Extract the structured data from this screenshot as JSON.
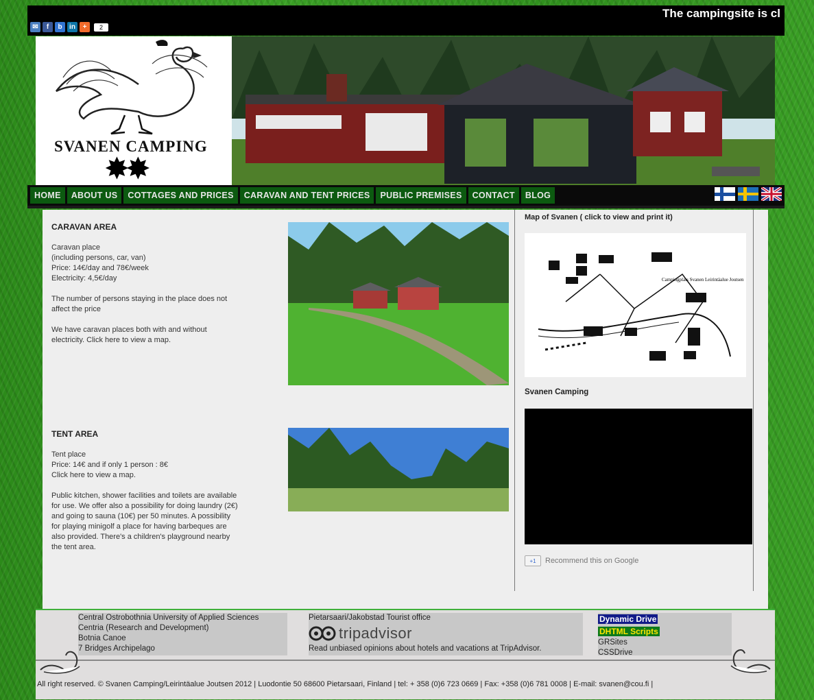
{
  "ticker": "The campingsite is cl",
  "share": {
    "icons": [
      "email-icon",
      "facebook-icon",
      "delicious-icon",
      "linkedin-icon",
      "google-plus-icon"
    ],
    "count": "2"
  },
  "logo": {
    "title": "SVANEN CAMPING"
  },
  "nav": {
    "items": [
      "HOME",
      "ABOUT US",
      "COTTAGES AND PRICES",
      "CARAVAN AND TENT PRICES",
      "PUBLIC PREMISES",
      "CONTACT",
      "BLOG"
    ]
  },
  "flags": [
    "finnish-flag-icon",
    "swedish-flag-icon",
    "uk-flag-icon"
  ],
  "caravan": {
    "title": "CARAVAN AREA",
    "lines": [
      "Caravan place",
      "(including persons, car, van)",
      "Price: 14€/day and 78€/week",
      "Electricity: 4,5€/day"
    ],
    "para2": [
      "The number of persons staying in the place does not",
      "affect the price"
    ],
    "para3": [
      "We have caravan places both with and without",
      "electricity. Click here to view a map."
    ]
  },
  "tent": {
    "title": "TENT AREA",
    "lines": [
      "Tent place",
      "Price: 14€ and if only 1 person : 8€",
      "Click here to view a map."
    ],
    "para2": [
      "Public kitchen, shower facilities and toilets are available",
      "for use. We offer also a possibility for doing laundry (2€)",
      "and going to sauna (10€) per 50 minutes. A possibility",
      "for playing minigolf a place for having barbeques are",
      "also provided. There's a children's playground nearby",
      "the tent area."
    ]
  },
  "sidebar": {
    "map_title": "Map of Svanen ( click to view and print it)",
    "map_label": "Campingplats Svanen\nLeirintäalue Joutsen",
    "video_title": "Svanen Camping",
    "gplus_label": "Recommend this on Google",
    "gplus_badge": "+1"
  },
  "footer": {
    "links1": [
      "Central Ostrobothnia University of Applied Sciences",
      "Centria (Research and Development)",
      "Botnia Canoe",
      "7 Bridges Archipelago"
    ],
    "tourist": "Pietarsaari/Jakobstad Tourist office",
    "tripadvisor": "tripadvisor",
    "trip_caption": "Read unbiased opinions about hotels and vacations at TripAdvisor.",
    "dd1": "Dynamic Drive",
    "dd2": "DHTML Scripts",
    "links3": [
      "GRSites",
      "CSSDrive"
    ],
    "copyright": "All right reserved. © Svanen Camping/Leirintäalue Joutsen 2012 | Luodontie 50 68600 Pietarsaari, Finland | tel: + 358 (0)6 723 0669 | Fax: +358 (0)6 781 0008 | E-mail: svanen@cou.fi |"
  }
}
